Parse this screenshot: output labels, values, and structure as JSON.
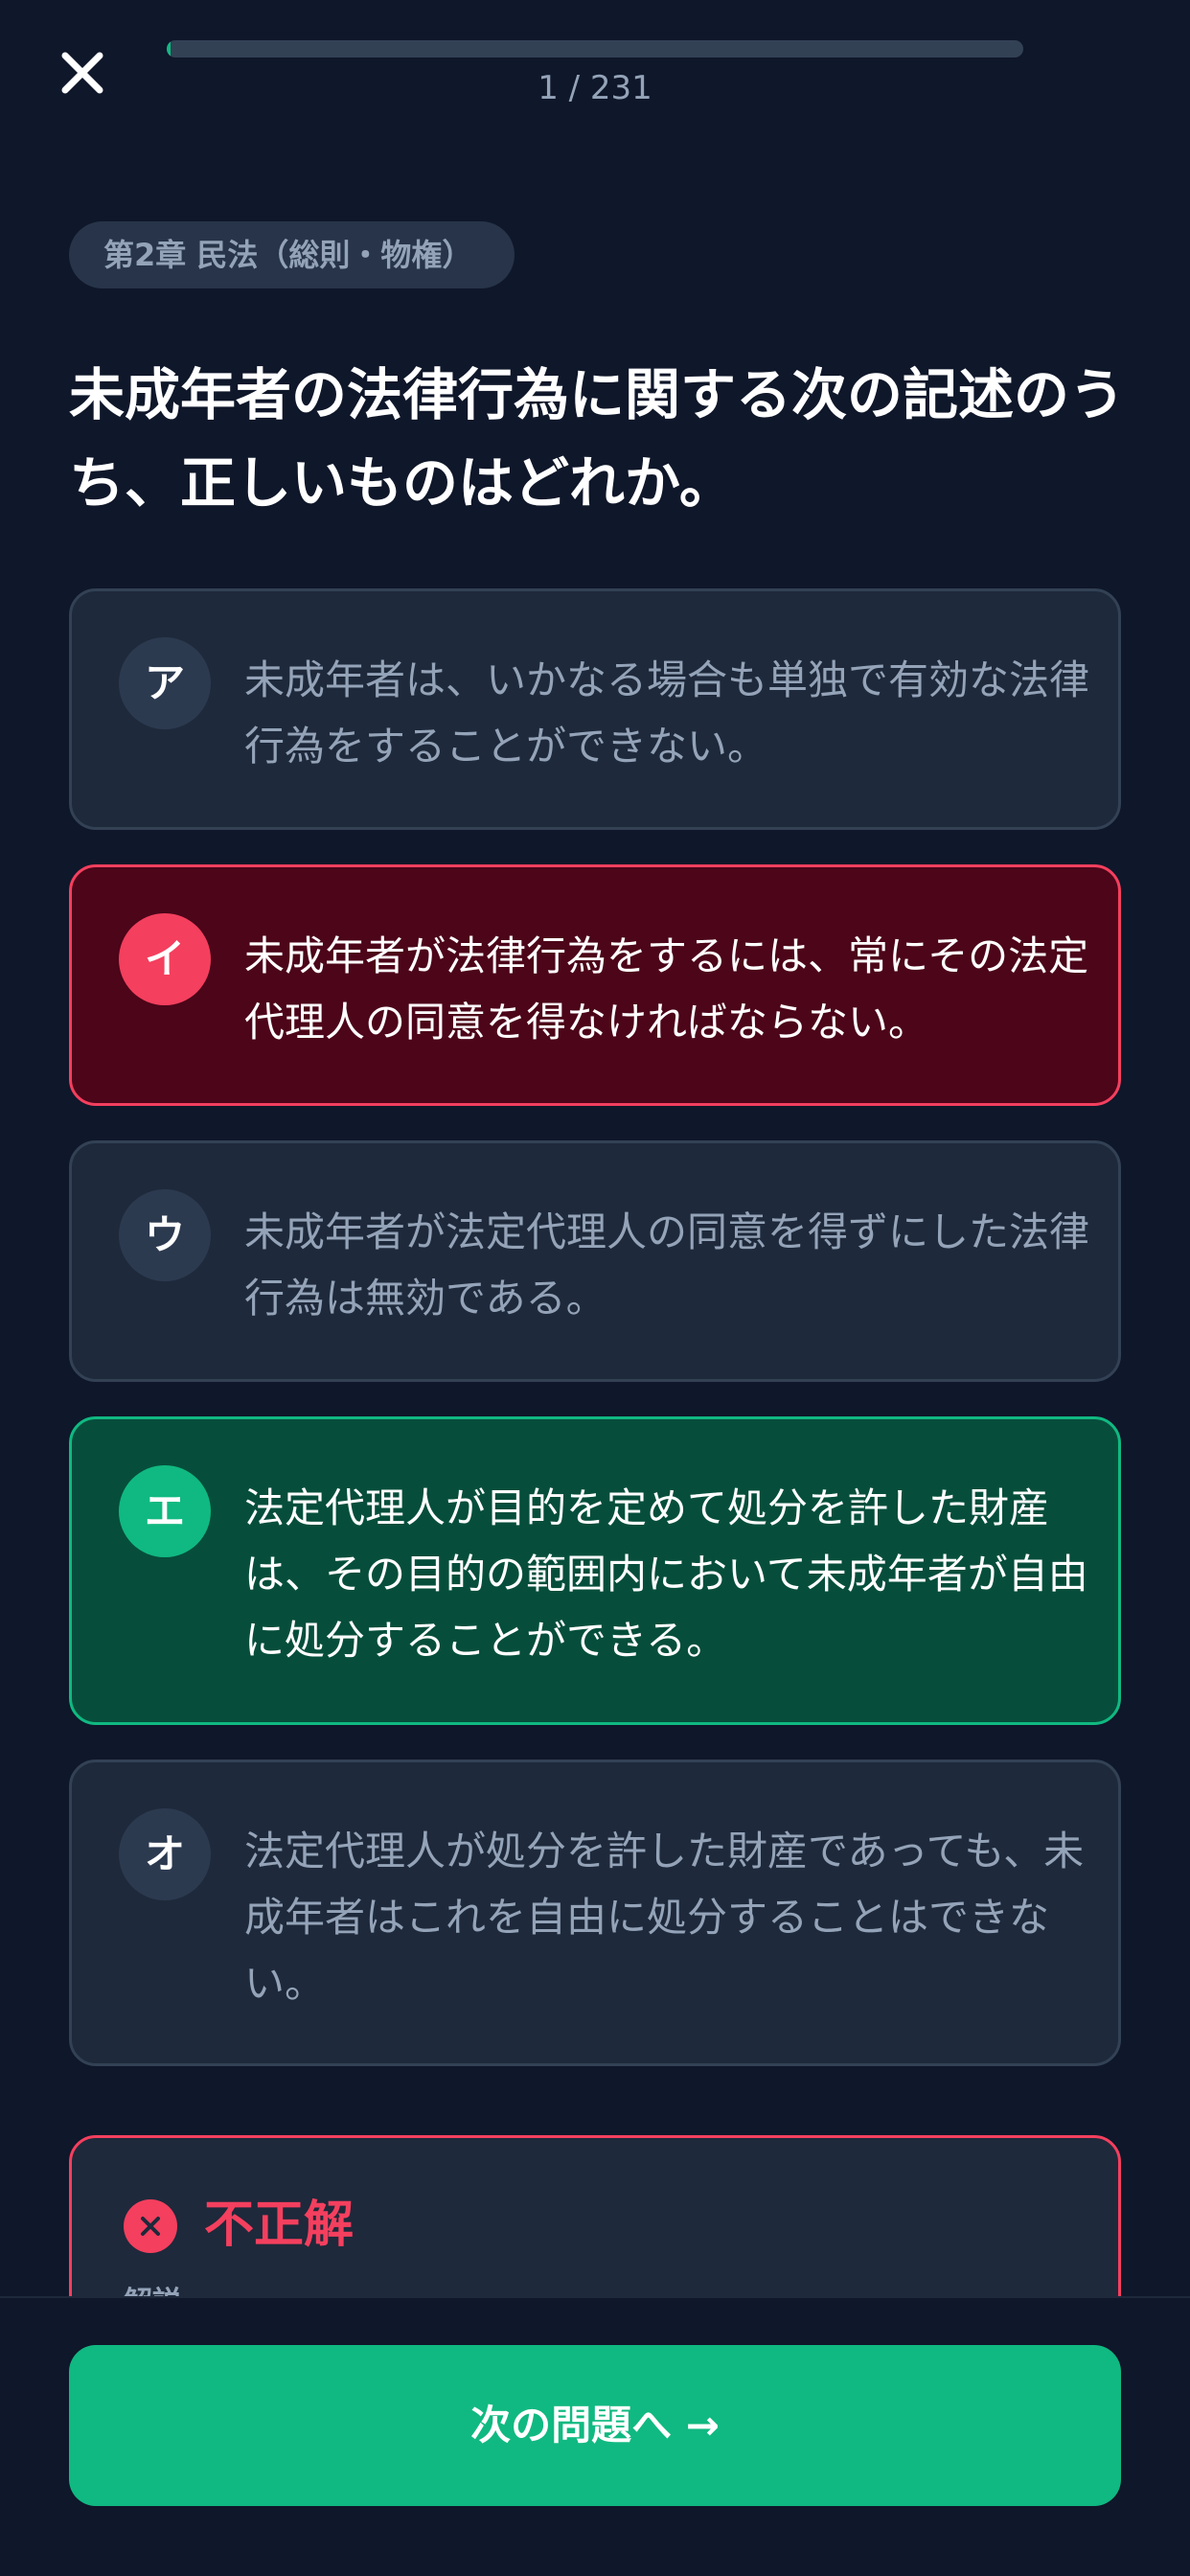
{
  "header": {
    "progress_text": "1 / 231",
    "progress_fraction": 0.0043,
    "close_icon": "close-icon"
  },
  "chapter": "第2章 民法（総則・物権）",
  "question": "未成年者の法律行為に関する次の記述のうち、正しいものはどれか。",
  "options": [
    {
      "marker": "ア",
      "text": "未成年者は、いかなる場合も単独で有効な法律行為をすることができない。",
      "state": "neutral"
    },
    {
      "marker": "イ",
      "text": "未成年者が法律行為をするには、常にその法定代理人の同意を得なければならない。",
      "state": "wrong"
    },
    {
      "marker": "ウ",
      "text": "未成年者が法定代理人の同意を得ずにした法律行為は無効である。",
      "state": "neutral"
    },
    {
      "marker": "エ",
      "text": "法定代理人が目的を定めて処分を許した財産は、その目的の範囲内において未成年者が自由に処分することができる。",
      "state": "correct"
    },
    {
      "marker": "オ",
      "text": "法定代理人が処分を許した財産であっても、未成年者はこれを自由に処分することはできない。",
      "state": "neutral"
    }
  ],
  "result": {
    "title": "不正解",
    "subtitle": "解説",
    "icon": "x-circle-icon"
  },
  "next_button": {
    "label": "次の問題へ →"
  },
  "colors": {
    "background": "#0f172a",
    "card": "#1e293b",
    "correct": "#10b981",
    "wrong": "#f43f5e",
    "muted_text": "#94a3b8"
  }
}
